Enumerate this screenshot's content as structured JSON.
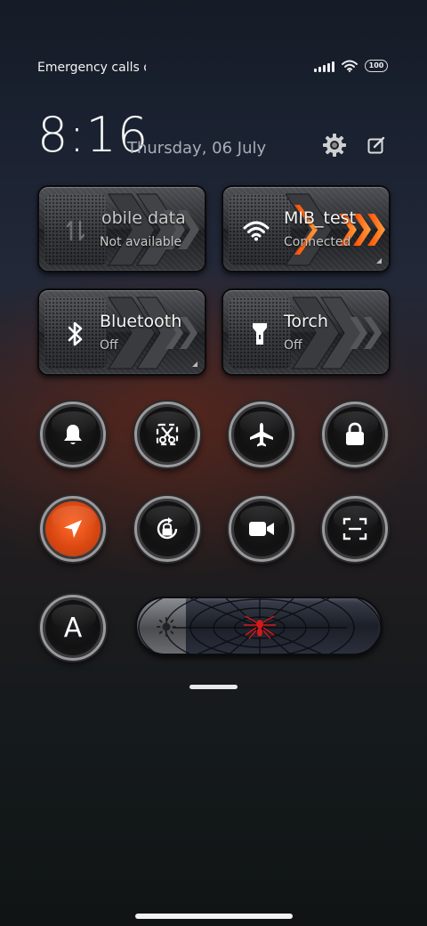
{
  "status_bar": {
    "carrier_text": "Emergency calls o",
    "battery": "100",
    "icons": [
      "signal-icon",
      "wifi-icon",
      "battery-icon"
    ]
  },
  "header": {
    "time": "8:16",
    "date": "Thursday, 06 July",
    "buttons": [
      "settings-icon",
      "edit-icon"
    ]
  },
  "tiles": [
    {
      "id": "mobile-data",
      "title": "obile data",
      "subtitle": "Not available",
      "icon": "mobile-data-icon",
      "state": "disabled"
    },
    {
      "id": "wifi",
      "title": "MIB_test",
      "subtitle": "Connected",
      "icon": "wifi-icon",
      "state": "on"
    },
    {
      "id": "bluetooth",
      "title": "Bluetooth",
      "subtitle": "Off",
      "icon": "bluetooth-icon",
      "state": "off"
    },
    {
      "id": "torch",
      "title": "Torch",
      "subtitle": "Off",
      "icon": "torch-icon",
      "state": "off"
    }
  ],
  "toggles_row1": [
    {
      "id": "sound",
      "icon": "bell-icon",
      "active": false
    },
    {
      "id": "screenshot",
      "icon": "scissors-icon",
      "active": false
    },
    {
      "id": "airplane",
      "icon": "airplane-icon",
      "active": false
    },
    {
      "id": "lock",
      "icon": "lock-icon",
      "active": false
    }
  ],
  "toggles_row2": [
    {
      "id": "location",
      "icon": "location-arrow-icon",
      "active": true
    },
    {
      "id": "auto-rotate",
      "icon": "rotate-lock-icon",
      "active": false
    },
    {
      "id": "screen-recorder",
      "icon": "video-camera-icon",
      "active": false
    },
    {
      "id": "scanner",
      "icon": "scan-icon",
      "active": false
    }
  ],
  "auto_brightness": {
    "label": "A",
    "icon": "auto-brightness-icon"
  },
  "brightness": {
    "level": 0.2,
    "icon": "sun-icon"
  },
  "colors": {
    "accent": "#ff6a1a",
    "location_active": "#e5501a"
  }
}
